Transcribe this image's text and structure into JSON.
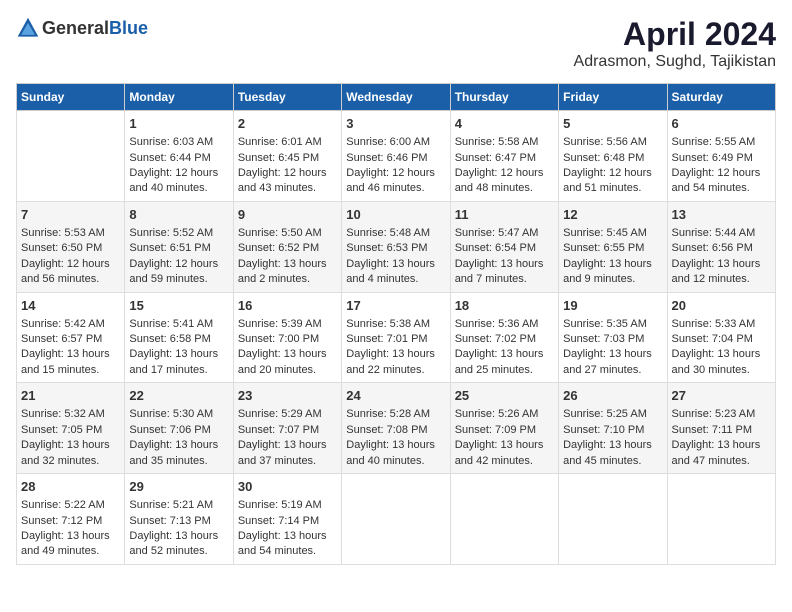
{
  "header": {
    "logo_general": "General",
    "logo_blue": "Blue",
    "month_title": "April 2024",
    "location": "Adrasmon, Sughd, Tajikistan"
  },
  "days_of_week": [
    "Sunday",
    "Monday",
    "Tuesday",
    "Wednesday",
    "Thursday",
    "Friday",
    "Saturday"
  ],
  "weeks": [
    [
      {
        "day": "",
        "sunrise": "",
        "sunset": "",
        "daylight": ""
      },
      {
        "day": "1",
        "sunrise": "Sunrise: 6:03 AM",
        "sunset": "Sunset: 6:44 PM",
        "daylight": "Daylight: 12 hours and 40 minutes."
      },
      {
        "day": "2",
        "sunrise": "Sunrise: 6:01 AM",
        "sunset": "Sunset: 6:45 PM",
        "daylight": "Daylight: 12 hours and 43 minutes."
      },
      {
        "day": "3",
        "sunrise": "Sunrise: 6:00 AM",
        "sunset": "Sunset: 6:46 PM",
        "daylight": "Daylight: 12 hours and 46 minutes."
      },
      {
        "day": "4",
        "sunrise": "Sunrise: 5:58 AM",
        "sunset": "Sunset: 6:47 PM",
        "daylight": "Daylight: 12 hours and 48 minutes."
      },
      {
        "day": "5",
        "sunrise": "Sunrise: 5:56 AM",
        "sunset": "Sunset: 6:48 PM",
        "daylight": "Daylight: 12 hours and 51 minutes."
      },
      {
        "day": "6",
        "sunrise": "Sunrise: 5:55 AM",
        "sunset": "Sunset: 6:49 PM",
        "daylight": "Daylight: 12 hours and 54 minutes."
      }
    ],
    [
      {
        "day": "7",
        "sunrise": "Sunrise: 5:53 AM",
        "sunset": "Sunset: 6:50 PM",
        "daylight": "Daylight: 12 hours and 56 minutes."
      },
      {
        "day": "8",
        "sunrise": "Sunrise: 5:52 AM",
        "sunset": "Sunset: 6:51 PM",
        "daylight": "Daylight: 12 hours and 59 minutes."
      },
      {
        "day": "9",
        "sunrise": "Sunrise: 5:50 AM",
        "sunset": "Sunset: 6:52 PM",
        "daylight": "Daylight: 13 hours and 2 minutes."
      },
      {
        "day": "10",
        "sunrise": "Sunrise: 5:48 AM",
        "sunset": "Sunset: 6:53 PM",
        "daylight": "Daylight: 13 hours and 4 minutes."
      },
      {
        "day": "11",
        "sunrise": "Sunrise: 5:47 AM",
        "sunset": "Sunset: 6:54 PM",
        "daylight": "Daylight: 13 hours and 7 minutes."
      },
      {
        "day": "12",
        "sunrise": "Sunrise: 5:45 AM",
        "sunset": "Sunset: 6:55 PM",
        "daylight": "Daylight: 13 hours and 9 minutes."
      },
      {
        "day": "13",
        "sunrise": "Sunrise: 5:44 AM",
        "sunset": "Sunset: 6:56 PM",
        "daylight": "Daylight: 13 hours and 12 minutes."
      }
    ],
    [
      {
        "day": "14",
        "sunrise": "Sunrise: 5:42 AM",
        "sunset": "Sunset: 6:57 PM",
        "daylight": "Daylight: 13 hours and 15 minutes."
      },
      {
        "day": "15",
        "sunrise": "Sunrise: 5:41 AM",
        "sunset": "Sunset: 6:58 PM",
        "daylight": "Daylight: 13 hours and 17 minutes."
      },
      {
        "day": "16",
        "sunrise": "Sunrise: 5:39 AM",
        "sunset": "Sunset: 7:00 PM",
        "daylight": "Daylight: 13 hours and 20 minutes."
      },
      {
        "day": "17",
        "sunrise": "Sunrise: 5:38 AM",
        "sunset": "Sunset: 7:01 PM",
        "daylight": "Daylight: 13 hours and 22 minutes."
      },
      {
        "day": "18",
        "sunrise": "Sunrise: 5:36 AM",
        "sunset": "Sunset: 7:02 PM",
        "daylight": "Daylight: 13 hours and 25 minutes."
      },
      {
        "day": "19",
        "sunrise": "Sunrise: 5:35 AM",
        "sunset": "Sunset: 7:03 PM",
        "daylight": "Daylight: 13 hours and 27 minutes."
      },
      {
        "day": "20",
        "sunrise": "Sunrise: 5:33 AM",
        "sunset": "Sunset: 7:04 PM",
        "daylight": "Daylight: 13 hours and 30 minutes."
      }
    ],
    [
      {
        "day": "21",
        "sunrise": "Sunrise: 5:32 AM",
        "sunset": "Sunset: 7:05 PM",
        "daylight": "Daylight: 13 hours and 32 minutes."
      },
      {
        "day": "22",
        "sunrise": "Sunrise: 5:30 AM",
        "sunset": "Sunset: 7:06 PM",
        "daylight": "Daylight: 13 hours and 35 minutes."
      },
      {
        "day": "23",
        "sunrise": "Sunrise: 5:29 AM",
        "sunset": "Sunset: 7:07 PM",
        "daylight": "Daylight: 13 hours and 37 minutes."
      },
      {
        "day": "24",
        "sunrise": "Sunrise: 5:28 AM",
        "sunset": "Sunset: 7:08 PM",
        "daylight": "Daylight: 13 hours and 40 minutes."
      },
      {
        "day": "25",
        "sunrise": "Sunrise: 5:26 AM",
        "sunset": "Sunset: 7:09 PM",
        "daylight": "Daylight: 13 hours and 42 minutes."
      },
      {
        "day": "26",
        "sunrise": "Sunrise: 5:25 AM",
        "sunset": "Sunset: 7:10 PM",
        "daylight": "Daylight: 13 hours and 45 minutes."
      },
      {
        "day": "27",
        "sunrise": "Sunrise: 5:23 AM",
        "sunset": "Sunset: 7:11 PM",
        "daylight": "Daylight: 13 hours and 47 minutes."
      }
    ],
    [
      {
        "day": "28",
        "sunrise": "Sunrise: 5:22 AM",
        "sunset": "Sunset: 7:12 PM",
        "daylight": "Daylight: 13 hours and 49 minutes."
      },
      {
        "day": "29",
        "sunrise": "Sunrise: 5:21 AM",
        "sunset": "Sunset: 7:13 PM",
        "daylight": "Daylight: 13 hours and 52 minutes."
      },
      {
        "day": "30",
        "sunrise": "Sunrise: 5:19 AM",
        "sunset": "Sunset: 7:14 PM",
        "daylight": "Daylight: 13 hours and 54 minutes."
      },
      {
        "day": "",
        "sunrise": "",
        "sunset": "",
        "daylight": ""
      },
      {
        "day": "",
        "sunrise": "",
        "sunset": "",
        "daylight": ""
      },
      {
        "day": "",
        "sunrise": "",
        "sunset": "",
        "daylight": ""
      },
      {
        "day": "",
        "sunrise": "",
        "sunset": "",
        "daylight": ""
      }
    ]
  ]
}
